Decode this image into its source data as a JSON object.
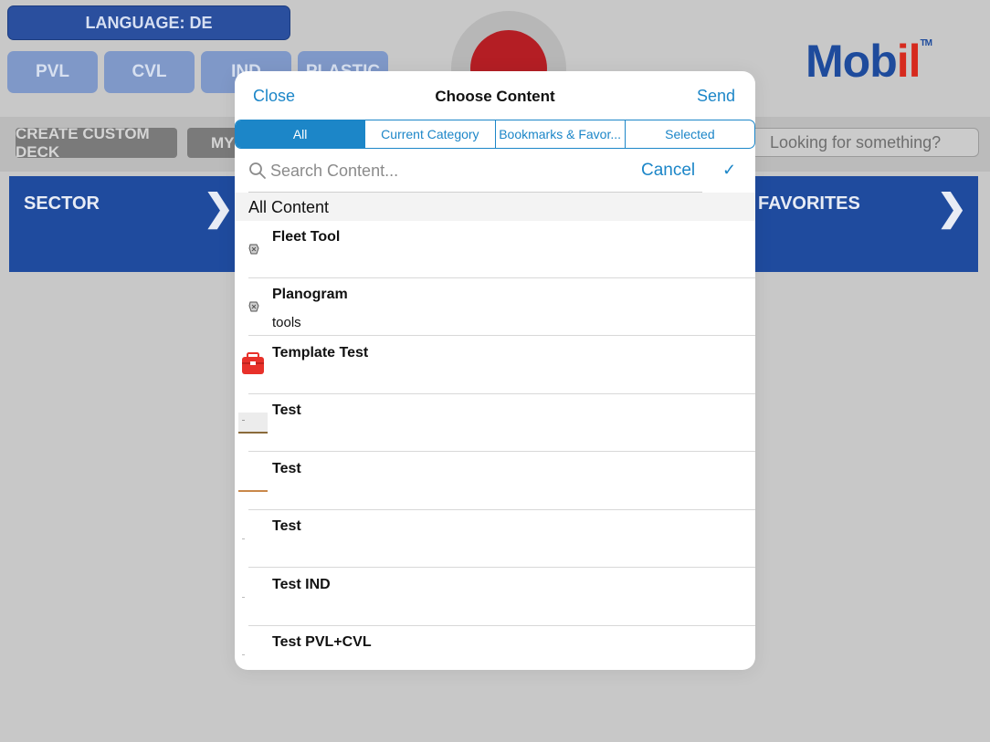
{
  "background": {
    "language_label": "LANGUAGE: DE",
    "categories": [
      "PVL",
      "CVL",
      "IND",
      "PLASTIC"
    ],
    "create_deck_label": "CREATE CUSTOM DECK",
    "my_label": "MY",
    "search_placeholder": "Looking for something?",
    "logo_text_main": "Mob",
    "logo_text_o": "il",
    "logo_tm": "TM",
    "tiles": [
      "SECTOR",
      "FAVORITES"
    ]
  },
  "modal": {
    "close_label": "Close",
    "title": "Choose Content",
    "send_label": "Send",
    "tabs": [
      "All",
      "Current Category",
      "Bookmarks & Favor...",
      "Selected"
    ],
    "active_tab": 0,
    "search_placeholder": "Search Content...",
    "cancel_label": "Cancel",
    "section_header": "All Content",
    "items": [
      {
        "title": "Fleet Tool",
        "subtitle": "",
        "icon": "tool-thumbnail-icon"
      },
      {
        "title": "Planogram",
        "subtitle": "tools",
        "icon": "tool-thumbnail-icon"
      },
      {
        "title": "Template Test",
        "subtitle": "",
        "icon": "toolbox-icon"
      },
      {
        "title": "Test",
        "subtitle": "",
        "icon": "slide-thumbnail-icon"
      },
      {
        "title": "Test",
        "subtitle": "",
        "icon": "slide-thumbnail-icon"
      },
      {
        "title": "Test",
        "subtitle": "",
        "icon": "blank-thumbnail-icon"
      },
      {
        "title": "Test IND",
        "subtitle": "",
        "icon": "blank-thumbnail-icon"
      },
      {
        "title": "Test PVL+CVL",
        "subtitle": "",
        "icon": "blank-thumbnail-icon"
      }
    ]
  },
  "colors": {
    "accent": "#1c86c8",
    "brand_blue": "#1f4b9e",
    "brand_red": "#d62a1e"
  }
}
